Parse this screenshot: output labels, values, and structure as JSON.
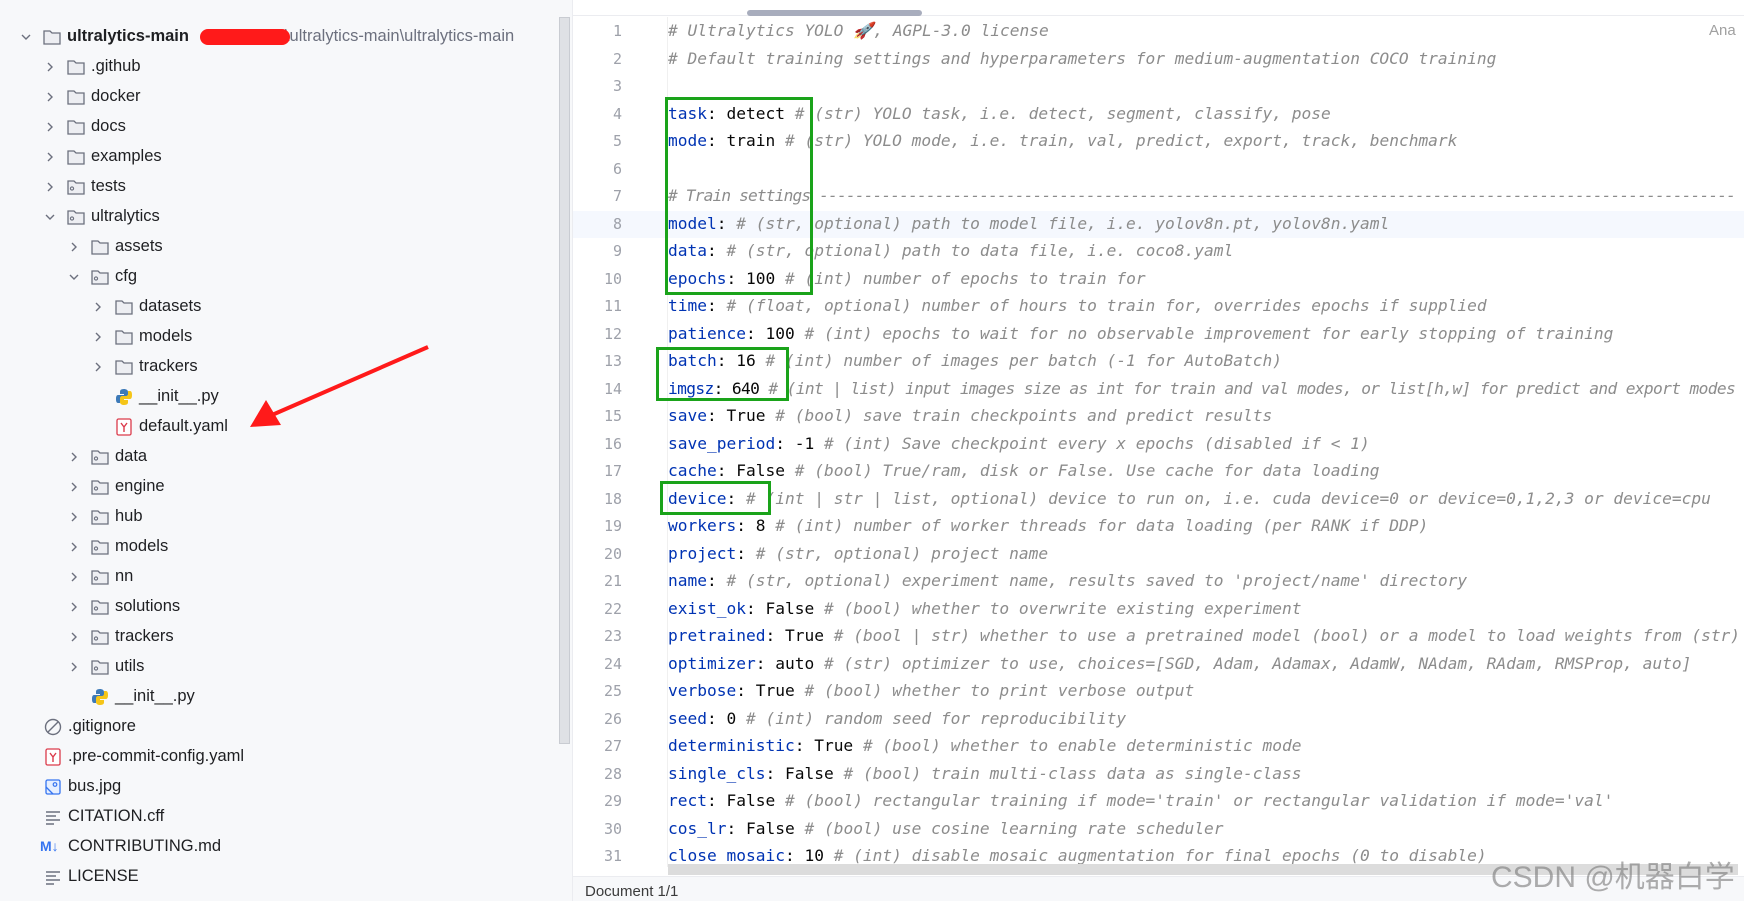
{
  "tree": {
    "root": {
      "name": "ultralytics-main",
      "path": "\\ultralytics-main\\ultralytics-main"
    },
    "items": [
      {
        "label": ".github",
        "level": 1,
        "type": "folder",
        "state": "collapsed"
      },
      {
        "label": "docker",
        "level": 1,
        "type": "folder",
        "state": "collapsed"
      },
      {
        "label": "docs",
        "level": 1,
        "type": "folder",
        "state": "collapsed"
      },
      {
        "label": "examples",
        "level": 1,
        "type": "folder",
        "state": "collapsed"
      },
      {
        "label": "tests",
        "level": 1,
        "type": "package",
        "state": "collapsed"
      },
      {
        "label": "ultralytics",
        "level": 1,
        "type": "package",
        "state": "expanded"
      },
      {
        "label": "assets",
        "level": 2,
        "type": "folder",
        "state": "collapsed"
      },
      {
        "label": "cfg",
        "level": 2,
        "type": "package",
        "state": "expanded"
      },
      {
        "label": "datasets",
        "level": 3,
        "type": "folder",
        "state": "collapsed"
      },
      {
        "label": "models",
        "level": 3,
        "type": "folder",
        "state": "collapsed"
      },
      {
        "label": "trackers",
        "level": 3,
        "type": "folder",
        "state": "collapsed"
      },
      {
        "label": "__init__.py",
        "level": 3,
        "type": "python"
      },
      {
        "label": "default.yaml",
        "level": 3,
        "type": "yaml"
      },
      {
        "label": "data",
        "level": 2,
        "type": "package",
        "state": "collapsed"
      },
      {
        "label": "engine",
        "level": 2,
        "type": "package",
        "state": "collapsed"
      },
      {
        "label": "hub",
        "level": 2,
        "type": "package",
        "state": "collapsed"
      },
      {
        "label": "models",
        "level": 2,
        "type": "package",
        "state": "collapsed"
      },
      {
        "label": "nn",
        "level": 2,
        "type": "package",
        "state": "collapsed"
      },
      {
        "label": "solutions",
        "level": 2,
        "type": "package",
        "state": "collapsed"
      },
      {
        "label": "trackers",
        "level": 2,
        "type": "package",
        "state": "collapsed"
      },
      {
        "label": "utils",
        "level": 2,
        "type": "package",
        "state": "collapsed"
      },
      {
        "label": "__init__.py",
        "level": 2,
        "type": "python"
      },
      {
        "label": ".gitignore",
        "level": 1,
        "type": "ignore"
      },
      {
        "label": ".pre-commit-config.yaml",
        "level": 1,
        "type": "yaml"
      },
      {
        "label": "bus.jpg",
        "level": 1,
        "type": "image"
      },
      {
        "label": "CITATION.cff",
        "level": 1,
        "type": "text"
      },
      {
        "label": "CONTRIBUTING.md",
        "level": 1,
        "type": "markdown"
      },
      {
        "label": "LICENSE",
        "level": 1,
        "type": "text"
      }
    ],
    "markdown_icon": "M↓"
  },
  "editor": {
    "highlighted_line": 8,
    "right_hint": "Ana",
    "lines": [
      {
        "c": "# Ultralytics YOLO 🚀, AGPL-3.0 license"
      },
      {
        "c": "# Default training settings and hyperparameters for medium-augmentation COCO training"
      },
      {},
      {
        "k": "task",
        "v": " detect ",
        "c": "# (str) YOLO task, i.e. detect, segment, classify, pose"
      },
      {
        "k": "mode",
        "v": " train ",
        "c": "# (str) YOLO mode, i.e. train, val, predict, export, track, benchmark"
      },
      {},
      {
        "c": "# Train settings -------------------------------------------------------------------------------------------------------"
      },
      {
        "k": "model",
        "v": " ",
        "c": "# (str, optional) path to model file, i.e. yolov8n.pt, yolov8n.yaml"
      },
      {
        "k": "data",
        "v": " ",
        "c": "# (str, optional) path to data file, i.e. coco8.yaml"
      },
      {
        "k": "epochs",
        "v": " 100 ",
        "c": "# (int) number of epochs to train for"
      },
      {
        "k": "time",
        "v": " ",
        "c": "# (float, optional) number of hours to train for, overrides epochs if supplied"
      },
      {
        "k": "patience",
        "v": " 100 ",
        "c": "# (int) epochs to wait for no observable improvement for early stopping of training"
      },
      {
        "k": "batch",
        "v": " 16 ",
        "c": "# (int) number of images per batch (-1 for AutoBatch)"
      },
      {
        "k": "imgsz",
        "v": " 640 ",
        "c": "# (int | list) input images size as int for train and val modes, or list[h,w] for predict and export modes"
      },
      {
        "k": "save",
        "v": " True ",
        "c": "# (bool) save train checkpoints and predict results"
      },
      {
        "k": "save_period",
        "v": " -1 ",
        "c": "# (int) Save checkpoint every x epochs (disabled if < 1)"
      },
      {
        "k": "cache",
        "v": " False ",
        "c": "# (bool) True/ram, disk or False. Use cache for data loading"
      },
      {
        "k": "device",
        "v": " ",
        "c": "# (int | str | list, optional) device to run on, i.e. cuda device=0 or device=0,1,2,3 or device=cpu"
      },
      {
        "k": "workers",
        "v": " 8 ",
        "c": "# (int) number of worker threads for data loading (per RANK if DDP)"
      },
      {
        "k": "project",
        "v": " ",
        "c": "# (str, optional) project name"
      },
      {
        "k": "name",
        "v": " ",
        "c": "# (str, optional) experiment name, results saved to 'project/name' directory"
      },
      {
        "k": "exist_ok",
        "v": " False ",
        "c": "# (bool) whether to overwrite existing experiment"
      },
      {
        "k": "pretrained",
        "v": " True ",
        "c": "# (bool | str) whether to use a pretrained model (bool) or a model to load weights from (str)"
      },
      {
        "k": "optimizer",
        "v": " auto ",
        "c": "# (str) optimizer to use, choices=[SGD, Adam, Adamax, AdamW, NAdam, RAdam, RMSProp, auto]"
      },
      {
        "k": "verbose",
        "v": " True ",
        "c": "# (bool) whether to print verbose output"
      },
      {
        "k": "seed",
        "v": " 0 ",
        "c": "# (int) random seed for reproducibility"
      },
      {
        "k": "deterministic",
        "v": " True ",
        "c": "# (bool) whether to enable deterministic mode"
      },
      {
        "k": "single_cls",
        "v": " False ",
        "c": "# (bool) train multi-class data as single-class"
      },
      {
        "k": "rect",
        "v": " False ",
        "c": "# (bool) rectangular training if mode='train' or rectangular validation if mode='val'"
      },
      {
        "k": "cos_lr",
        "v": " False ",
        "c": "# (bool) use cosine learning rate scheduler"
      },
      {
        "k": "close_mosaic",
        "v": " 10 ",
        "c": "# (int) disable mosaic augmentation for final epochs (0 to disable)"
      }
    ]
  },
  "status": {
    "document": "Document 1/1"
  },
  "watermark": "CSDN @机器白学",
  "colors": {
    "highlight_box": "#1aa31a",
    "arrow": "#ff1a1a",
    "key": "#0033b3",
    "comment": "#8c8c8c"
  }
}
